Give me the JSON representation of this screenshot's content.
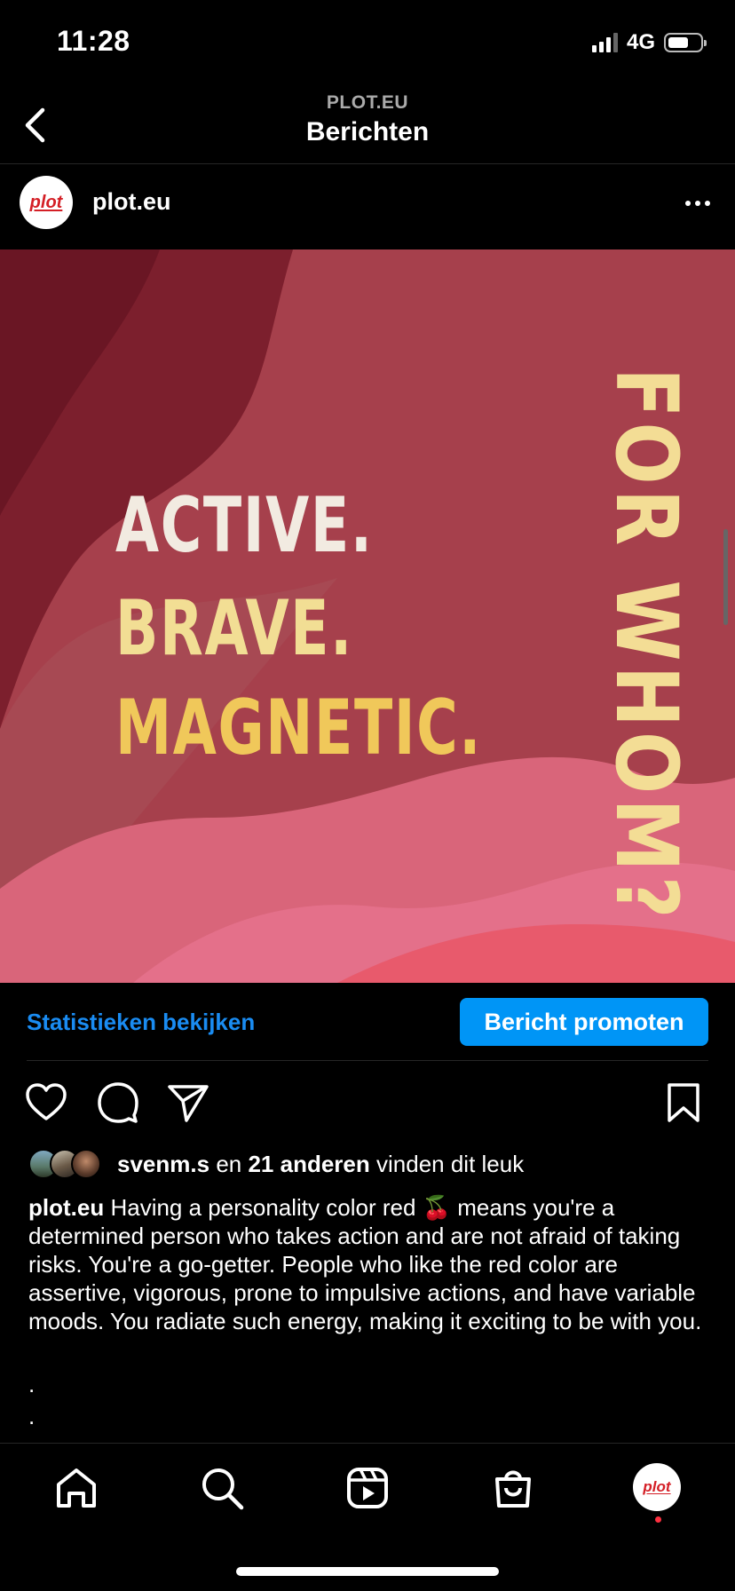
{
  "status_bar": {
    "time": "11:28",
    "network": "4G",
    "battery_level": 0.6
  },
  "header": {
    "subtitle": "PLOT.EU",
    "title": "Berichten",
    "back_icon": "chevron-left-icon"
  },
  "post": {
    "account": {
      "avatar_text": "plot",
      "username": "plot.eu",
      "more_icon": "more-horizontal-icon"
    },
    "image": {
      "lines": [
        "ACTIVE.",
        "BRAVE.",
        "MAGNETIC."
      ],
      "vertical_text": "FOR WHOM?",
      "colors": {
        "line1": "#f2ebe1",
        "line2": "#f2de94",
        "line3": "#f0c85a",
        "vertical": "#f3dd95"
      }
    },
    "insights_label": "Statistieken bekijken",
    "promote_label": "Bericht promoten",
    "actions": {
      "like": "heart-icon",
      "comment": "comment-icon",
      "share": "send-icon",
      "save": "bookmark-icon"
    },
    "likes": {
      "user": "svenm.s",
      "connector": "en",
      "others": "21 anderen",
      "suffix": "vinden dit leuk"
    },
    "caption": {
      "username": "plot.eu",
      "text": "Having a personality color red 🍒 means you're a determined person who takes action and are not afraid of taking risks. You're a go-getter. People who like the red color are assertive, vigorous, prone to impulsive actions, and have variable moods. You radiate such energy, making it exciting to be with you.",
      "extra_lines": [
        ".",
        "."
      ]
    }
  },
  "tab_bar": {
    "items": [
      "home-icon",
      "search-icon",
      "reels-icon",
      "shop-icon"
    ],
    "profile_avatar_text": "plot"
  }
}
